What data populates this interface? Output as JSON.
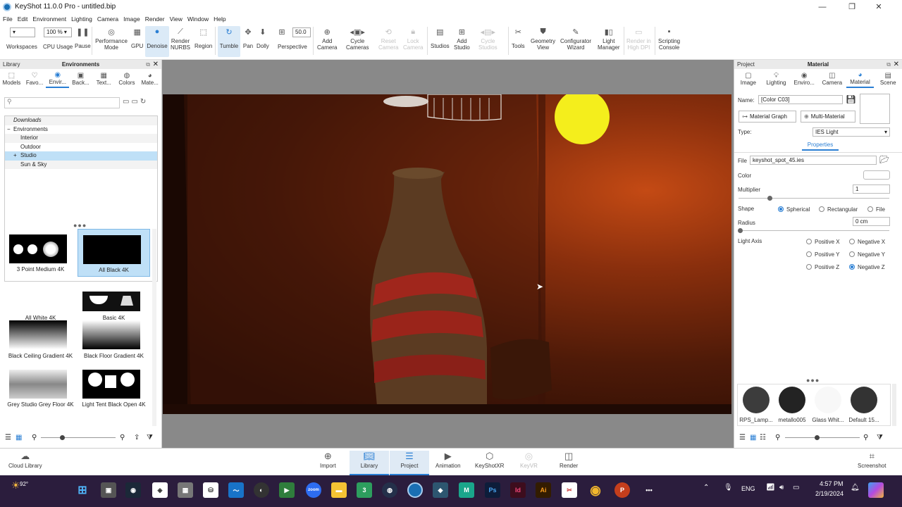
{
  "window": {
    "title": "KeyShot 11.0.0 Pro  - untitled.bip"
  },
  "menu": [
    "File",
    "Edit",
    "Environment",
    "Lighting",
    "Camera",
    "Image",
    "Render",
    "View",
    "Window",
    "Help"
  ],
  "toolbar": {
    "zoom_value": "100 %",
    "focal_value": "50.0",
    "items": {
      "workspaces": "Workspaces",
      "cpu": "CPU Usage",
      "pause": "Pause",
      "performance": "Performance\nMode",
      "gpu": "GPU",
      "denoise": "Denoise",
      "render_nurbs": "Render\nNURBS",
      "region": "Region",
      "tumble": "Tumble",
      "pan": "Pan",
      "dolly": "Dolly",
      "perspective": "Perspective",
      "add_camera": "Add\nCamera",
      "cycle_cameras": "Cycle\nCameras",
      "reset_camera": "Reset\nCamera",
      "lock_camera": "Lock\nCamera",
      "studios": "Studios",
      "add_studio": "Add\nStudio",
      "cycle_studios": "Cycle\nStudios",
      "tools": "Tools",
      "geometry_view": "Geometry\nView",
      "configurator": "Configurator\nWizard",
      "light_manager": "Light\nManager",
      "render_hidpi": "Render in\nHigh DPI",
      "scripting": "Scripting\nConsole"
    }
  },
  "left_panel": {
    "header_left": "Library",
    "header_title": "Environments",
    "tabs": [
      "Models",
      "Favo...",
      "Envir...",
      "Back...",
      "Text...",
      "Colors",
      "Mate..."
    ],
    "tree": [
      "Downloads",
      "Environments",
      "Interior",
      "Outdoor",
      "Studio",
      "Sun & Sky"
    ],
    "thumbnails": [
      "3 Point Medium 4K",
      "All Black 4K",
      "All White 4K",
      "Basic 4K",
      "Black Ceiling Gradient 4K",
      "Black Floor Gradient 4K",
      "Grey Studio Grey Floor 4K",
      "Light Tent Black Open 4K"
    ]
  },
  "right_panel": {
    "header_left": "Project",
    "header_title": "Material",
    "tabs": [
      "Image",
      "Lighting",
      "Enviro...",
      "Camera",
      "Material",
      "Scene"
    ],
    "name_label": "Name:",
    "name_value": "[Color C03]",
    "material_graph": "Material Graph",
    "multi_material": "Multi-Material",
    "type_label": "Type:",
    "type_value": "IES Light",
    "properties_tab": "Properties",
    "file_label": "File",
    "file_value": "keyshot_spot_45.ies",
    "color_label": "Color",
    "multiplier_label": "Multiplier",
    "multiplier_value": "1",
    "shape_label": "Shape",
    "shape_options": [
      "Spherical",
      "Rectangular",
      "File"
    ],
    "radius_label": "Radius",
    "radius_value": "0 cm",
    "light_axis_label": "Light Axis",
    "axis_options": [
      "Positive X",
      "Negative X",
      "Positive Y",
      "Negative Y",
      "Positive Z",
      "Negative Z"
    ],
    "swatches": [
      "RPS_Lamp...",
      "metallo005",
      "Glass Whit...",
      "Default 15..."
    ]
  },
  "bottom_bar": {
    "cloud_library": "Cloud Library",
    "import": "Import",
    "library": "Library",
    "project": "Project",
    "animation": "Animation",
    "keyshotxr": "KeyShotXR",
    "keyvr": "KeyVR",
    "render": "Render",
    "screenshot": "Screenshot"
  },
  "taskbar": {
    "weather": "92°",
    "language": "ENG",
    "time": "4:57 PM",
    "date": "2/19/2024"
  },
  "colors": {
    "accent": "#2a7fd4",
    "selection": "#bfe0f7",
    "taskbar": "#2b1d3d"
  }
}
